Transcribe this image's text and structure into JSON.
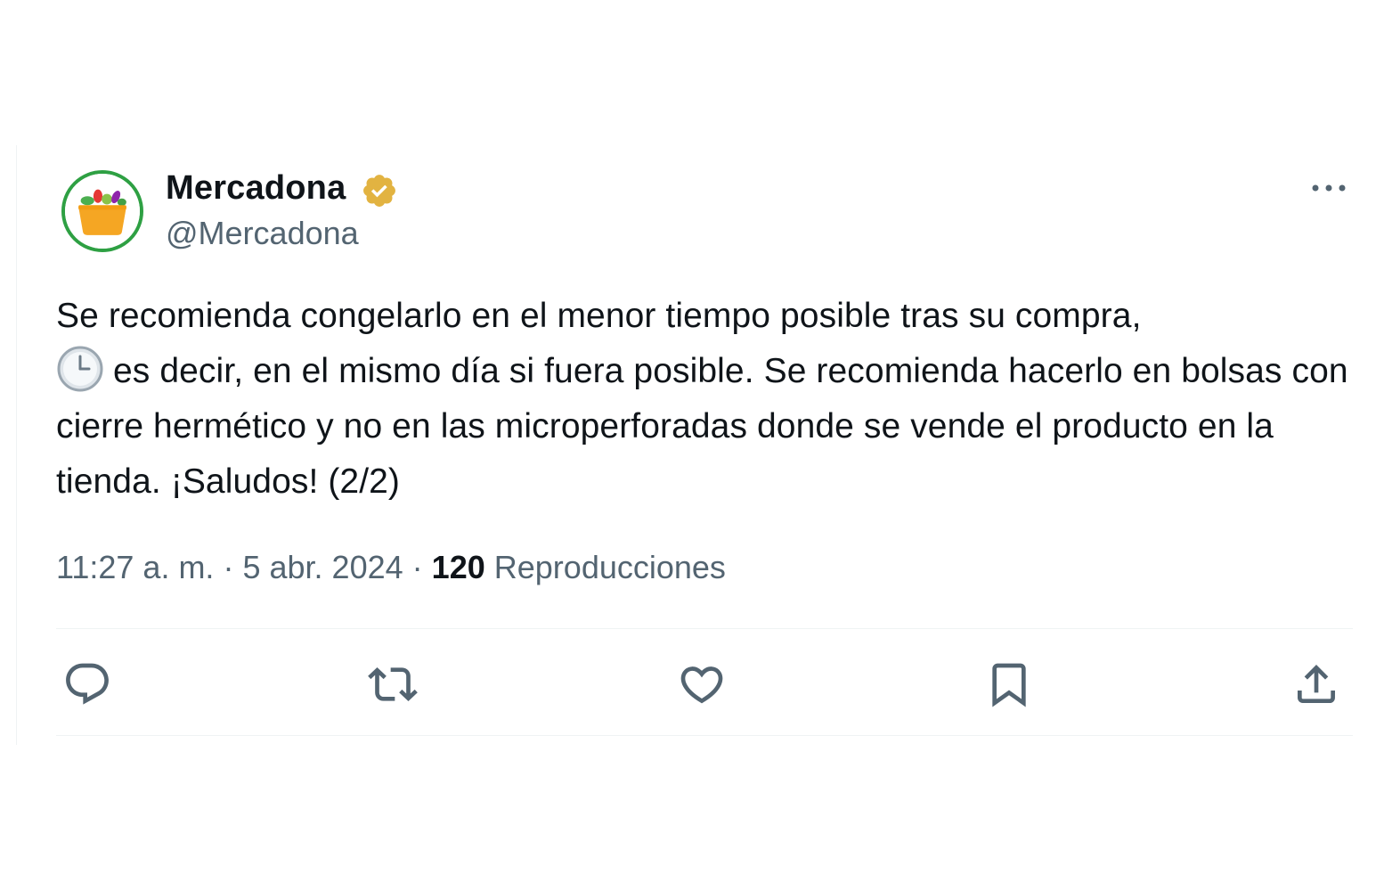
{
  "author": {
    "name": "Mercadona",
    "handle": "@Mercadona",
    "verified_color": "#e2b341",
    "avatar_ring_color": "#2ea043"
  },
  "tweet": {
    "text_before_emoji": "Se recomienda congelarlo en el menor tiempo posible tras su compra,",
    "emoji": "clock-icon",
    "text_after_emoji": "es decir, en el mismo día si fuera posible. Se recomienda hacerlo en bolsas con cierre hermético y no en las microperforadas donde se vende el producto en la tienda. ¡Saludos! (2/2)"
  },
  "meta": {
    "time": "11:27 a. m.",
    "separator": "·",
    "date": "5 abr. 2024",
    "views_count": "120",
    "views_label": "Reproducciones"
  },
  "actions": [
    {
      "icon": "reply-icon"
    },
    {
      "icon": "retweet-icon"
    },
    {
      "icon": "like-icon"
    },
    {
      "icon": "bookmark-icon"
    },
    {
      "icon": "share-icon"
    }
  ],
  "colors": {
    "text": "#0f1419",
    "secondary": "#536471",
    "divider": "#eff3f4"
  }
}
